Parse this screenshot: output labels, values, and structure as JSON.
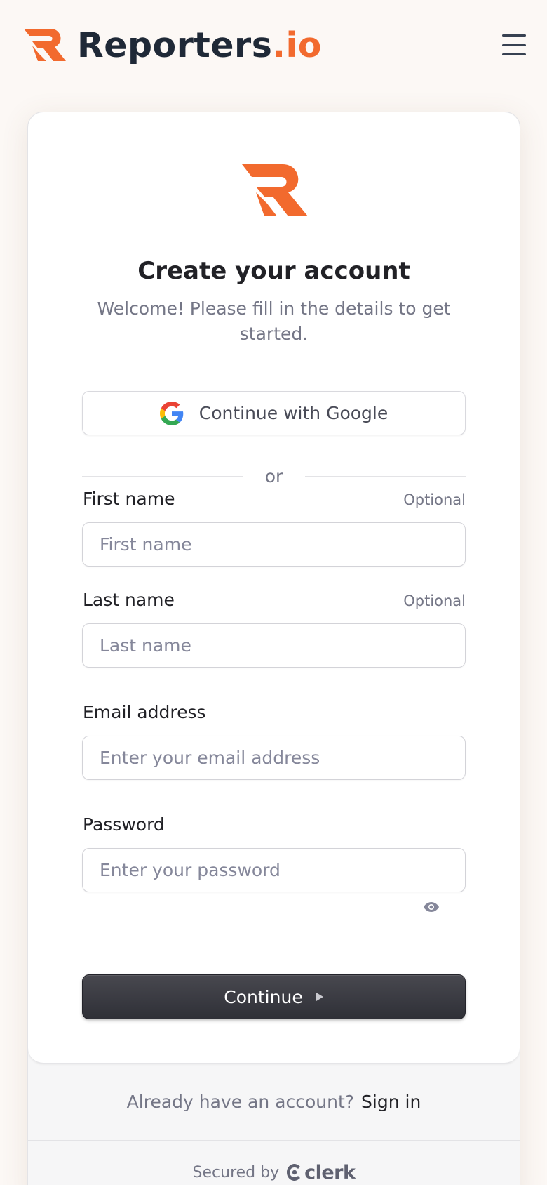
{
  "header": {
    "brand_name": "Reporters",
    "brand_tld": ".io",
    "menu_icon": "hamburger-menu-icon"
  },
  "colors": {
    "brand_orange": "#f26a2e",
    "primary_button": "#2f3037",
    "page_background": "#fcf8f5"
  },
  "signup": {
    "title": "Create your account",
    "subtitle": "Welcome! Please fill in the details to get started.",
    "google_button_label": "Continue with Google",
    "divider_text": "or",
    "fields": {
      "first_name": {
        "label": "First name",
        "hint": "Optional",
        "placeholder": "First name",
        "value": ""
      },
      "last_name": {
        "label": "Last name",
        "hint": "Optional",
        "placeholder": "Last name",
        "value": ""
      },
      "email": {
        "label": "Email address",
        "placeholder": "Enter your email address",
        "value": ""
      },
      "password": {
        "label": "Password",
        "placeholder": "Enter your password",
        "value": ""
      }
    },
    "continue_label": "Continue"
  },
  "footer": {
    "prompt": "Already have an account?",
    "signin_link": "Sign in",
    "secured_by": "Secured by",
    "provider": "clerk"
  }
}
